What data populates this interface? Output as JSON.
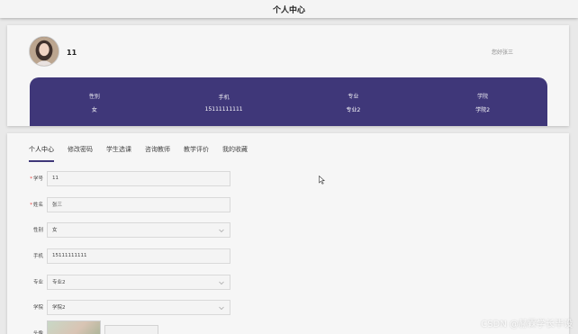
{
  "header": {
    "title": "个人中心"
  },
  "profile": {
    "username": "11",
    "greeting": "您好张三",
    "info": [
      {
        "label": "性别",
        "value": "女"
      },
      {
        "label": "手机",
        "value": "15111111111"
      },
      {
        "label": "专业",
        "value": "专业2"
      },
      {
        "label": "学院",
        "value": "学院2"
      }
    ]
  },
  "tabs": [
    "个人中心",
    "修改密码",
    "学生选课",
    "咨询教师",
    "教学评价",
    "我的收藏"
  ],
  "form": {
    "student_id": {
      "label": "学号",
      "value": "11",
      "required": true
    },
    "name": {
      "label": "姓名",
      "value": "张三",
      "required": true
    },
    "gender": {
      "label": "性别",
      "value": "女"
    },
    "phone": {
      "label": "手机",
      "value": "15111111111"
    },
    "major": {
      "label": "专业",
      "value": "专业2"
    },
    "college": {
      "label": "学院",
      "value": "学院2"
    },
    "avatar": {
      "label": "头像"
    }
  },
  "watermark": "CSDN @赫霖学长毕设",
  "colors": {
    "accent": "#3f3779",
    "required": "#e53935"
  }
}
